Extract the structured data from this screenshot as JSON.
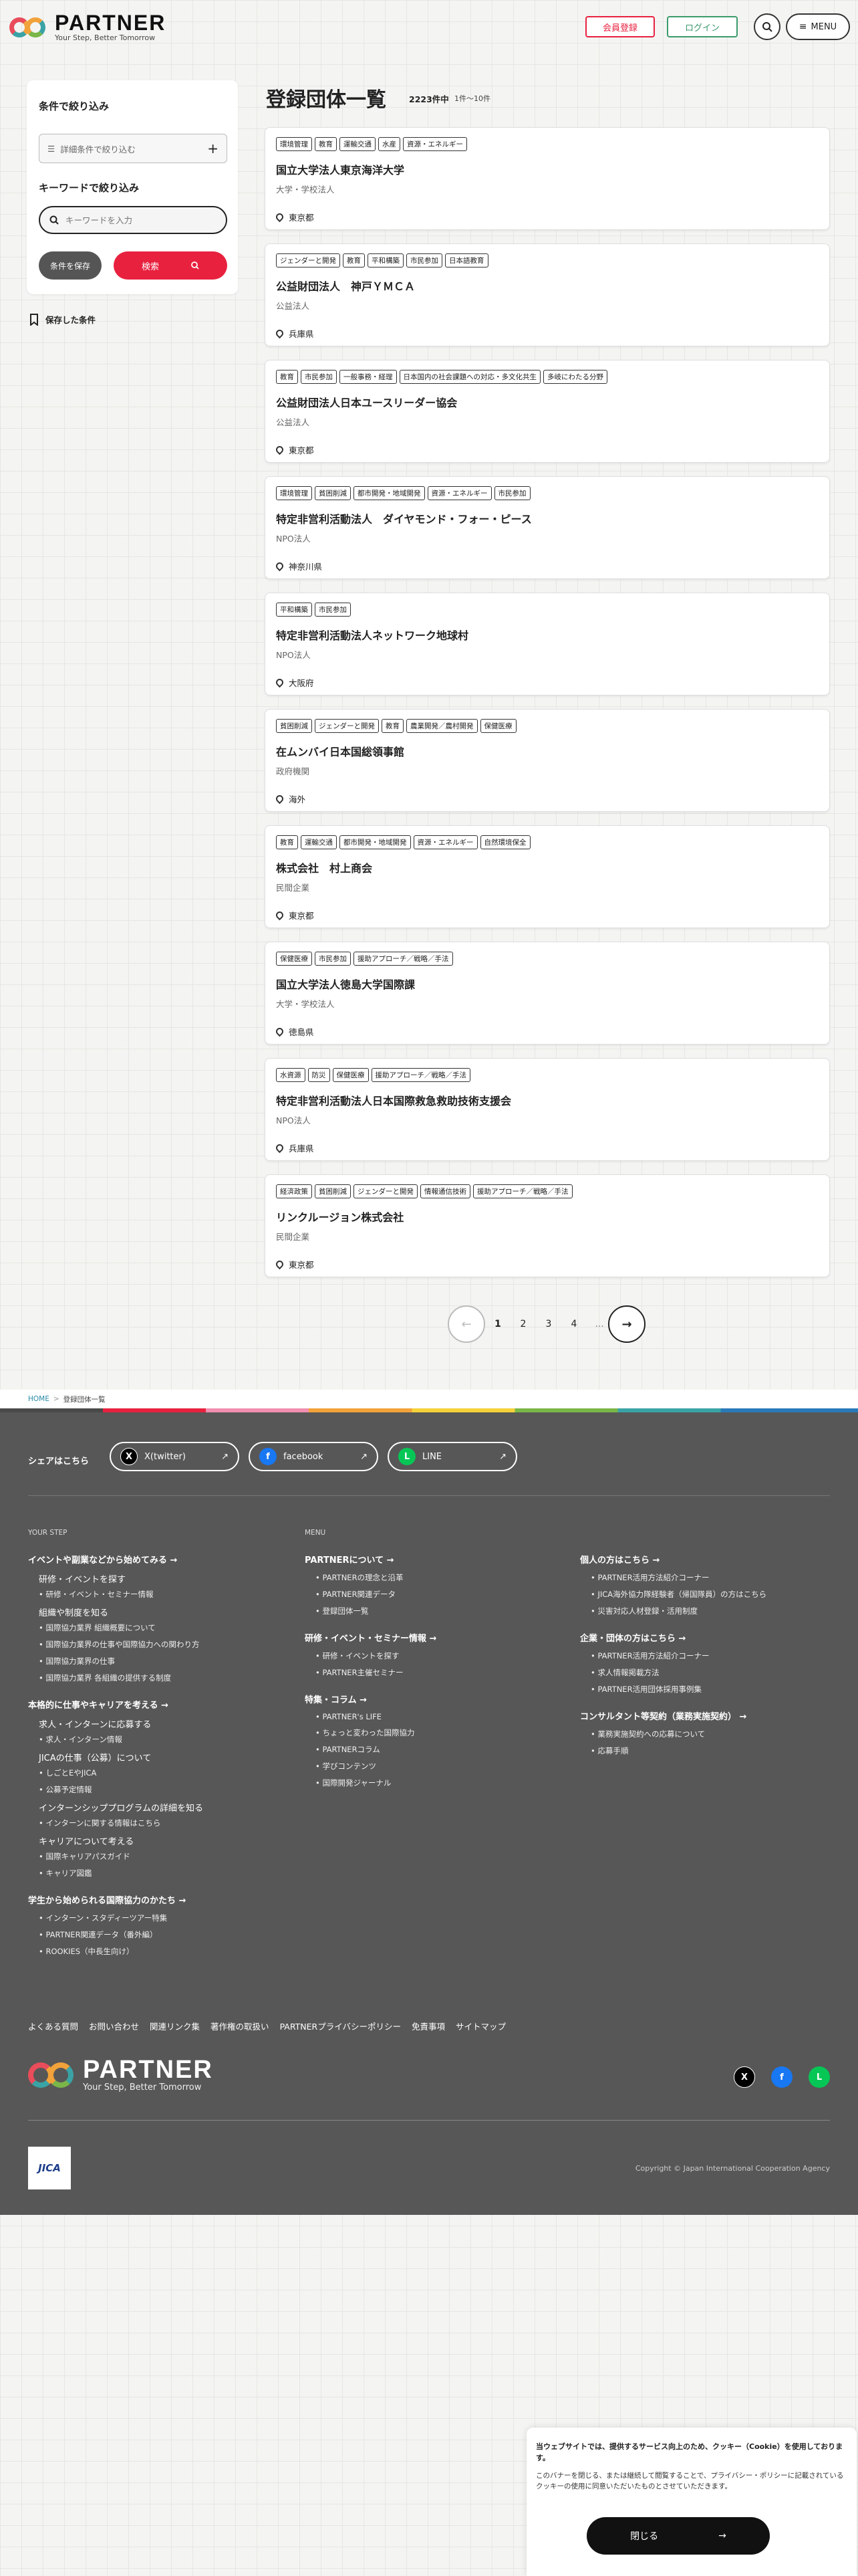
{
  "header": {
    "brand": "PARTNER",
    "tagline": "Your Step, Better Tomorrow",
    "register": "会員登録",
    "login": "ログイン",
    "menu": "MENU"
  },
  "sidebar": {
    "filter_title": "条件で絞り込み",
    "detail_filter": "詳細条件で絞り込む",
    "keyword_title": "キーワードで絞り込み",
    "keyword_placeholder": "キーワードを入力",
    "save": "条件を保存",
    "search": "検索",
    "saved": "保存した条件"
  },
  "main": {
    "title": "登録団体一覧",
    "count": "2223件中",
    "range": "1件〜10件"
  },
  "orgs": [
    {
      "tags": [
        "環境管理",
        "教育",
        "運輸交通",
        "水産",
        "資源・エネルギー"
      ],
      "name": "国立大学法人東京海洋大学",
      "type": "大学・学校法人",
      "location": "東京都"
    },
    {
      "tags": [
        "ジェンダーと開発",
        "教育",
        "平和構築",
        "市民参加",
        "日本語教育"
      ],
      "name": "公益財団法人　神戸ＹＭＣＡ",
      "type": "公益法人",
      "location": "兵庫県"
    },
    {
      "tags": [
        "教育",
        "市民参加",
        "一般事務・経理",
        "日本国内の社会課題への対応・多文化共生",
        "多岐にわたる分野"
      ],
      "name": "公益財団法人日本ユースリーダー協会",
      "type": "公益法人",
      "location": "東京都"
    },
    {
      "tags": [
        "環境管理",
        "貧困削減",
        "都市開発・地域開発",
        "資源・エネルギー",
        "市民参加"
      ],
      "name": "特定非営利活動法人　ダイヤモンド・フォー・ピース",
      "type": "NPO法人",
      "location": "神奈川県"
    },
    {
      "tags": [
        "平和構築",
        "市民参加"
      ],
      "name": "特定非営利活動法人ネットワーク地球村",
      "type": "NPO法人",
      "location": "大阪府"
    },
    {
      "tags": [
        "貧困削減",
        "ジェンダーと開発",
        "教育",
        "農業開発／農村開発",
        "保健医療"
      ],
      "name": "在ムンバイ日本国総領事館",
      "type": "政府機関",
      "location": "海外"
    },
    {
      "tags": [
        "教育",
        "運輸交通",
        "都市開発・地域開発",
        "資源・エネルギー",
        "自然環境保全"
      ],
      "name": "株式会社　村上商会",
      "type": "民間企業",
      "location": "東京都"
    },
    {
      "tags": [
        "保健医療",
        "市民参加",
        "援助アプローチ／戦略／手法"
      ],
      "name": "国立大学法人徳島大学国際課",
      "type": "大学・学校法人",
      "location": "徳島県"
    },
    {
      "tags": [
        "水資源",
        "防災",
        "保健医療",
        "援助アプローチ／戦略／手法"
      ],
      "name": "特定非営利活動法人日本国際救急救助技術支援会",
      "type": "NPO法人",
      "location": "兵庫県"
    },
    {
      "tags": [
        "経済政策",
        "貧困削減",
        "ジェンダーと開発",
        "情報通信技術",
        "援助アプローチ／戦略／手法"
      ],
      "name": "リンクルージョン株式会社",
      "type": "民間企業",
      "location": "東京都"
    }
  ],
  "pagination": {
    "pages": [
      "1",
      "2",
      "3",
      "4"
    ],
    "ellipsis": "..."
  },
  "breadcrumb": {
    "home": "HOME",
    "sep": ">",
    "current": "登録団体一覧"
  },
  "footer": {
    "share_label": "シェアはこちら",
    "share": [
      {
        "icon": "X",
        "label": "X(twitter)"
      },
      {
        "icon": "f",
        "label": "facebook"
      },
      {
        "icon": "L",
        "label": "LINE"
      }
    ],
    "col1_title": "YOUR STEP",
    "col2_title": "MENU",
    "col1": [
      {
        "h": "イベントや副業などから始めてみる"
      },
      {
        "s": "研修・イベントを探す"
      },
      {
        "i": "研修・イベント・セミナー情報"
      },
      {
        "s": "組織や制度を知る"
      },
      {
        "i": "国際協力業界 組織概要について"
      },
      {
        "i": "国際協力業界の仕事や国際協力への関わり方"
      },
      {
        "i": "国際協力業界の仕事"
      },
      {
        "i": "国際協力業界 各組織の提供する制度"
      },
      {
        "h": "本格的に仕事やキャリアを考える"
      },
      {
        "s": "求人・インターンに応募する"
      },
      {
        "i": "求人・インターン情報"
      },
      {
        "s": "JICAの仕事（公募）について"
      },
      {
        "i": "しごとEやJICA"
      },
      {
        "i": "公募予定情報"
      },
      {
        "s": "インターンシッププログラムの詳細を知る"
      },
      {
        "i": "インターンに関する情報はこちら"
      },
      {
        "s": "キャリアについて考える"
      },
      {
        "i": "国際キャリアパスガイド"
      },
      {
        "i": "キャリア図鑑"
      },
      {
        "h": "学生から始められる国際協力のかたち"
      },
      {
        "i": "インターン・スタディーツアー特集"
      },
      {
        "i": "PARTNER関連データ（番外編）"
      },
      {
        "i": "ROOKIES（中長生向け）"
      }
    ],
    "col2": [
      {
        "h": "PARTNERについて"
      },
      {
        "i": "PARTNERの理念と沿革"
      },
      {
        "i": "PARTNER関連データ"
      },
      {
        "i": "登録団体一覧"
      },
      {
        "h": "研修・イベント・セミナー情報"
      },
      {
        "i": "研修・イベントを探す"
      },
      {
        "i": "PARTNER主催セミナー"
      },
      {
        "h": "特集・コラム"
      },
      {
        "i": "PARTNER's LIFE"
      },
      {
        "i": "ちょっと変わった国際協力"
      },
      {
        "i": "PARTNERコラム"
      },
      {
        "i": "学びコンテンツ"
      },
      {
        "i": "国際開発ジャーナル"
      }
    ],
    "col3": [
      {
        "h": "個人の方はこちら"
      },
      {
        "i": "PARTNER活用方法紹介コーナー"
      },
      {
        "i": "JICA海外協力隊経験者（帰国隊員）の方はこちら"
      },
      {
        "i": "災害対応人材登録・活用制度"
      },
      {
        "h": "企業・団体の方はこちら"
      },
      {
        "i": "PARTNER活用方法紹介コーナー"
      },
      {
        "i": "求人情報掲載方法"
      },
      {
        "i": "PARTNER活用団体採用事例集"
      },
      {
        "h": "コンサルタント等契約（業務実施契約）"
      },
      {
        "i": "業務実施契約への応募について"
      },
      {
        "i": "応募手順"
      }
    ],
    "links": [
      "よくある質問",
      "お問い合わせ",
      "関連リンク集",
      "著作権の取扱い",
      "PARTNERプライバシーポリシー",
      "免責事項",
      "サイトマップ"
    ],
    "jica": "JICA",
    "copyright": "Copyright © Japan International Cooperation Agency"
  },
  "cookie": {
    "text1": "当ウェブサイトでは、提供するサービス向上のため、クッキー（Cookie）を使用しております。",
    "text2": "このバナーを閉じる、または継続して閲覧することで、プライバシー・ポリシーに記載されているクッキーの使用に同意いただいたものとさせていただきます。",
    "close": "閉じる"
  },
  "colors": {
    "accent": "#e8213f",
    "green": "#3a9b6b",
    "footer": "#575757"
  }
}
